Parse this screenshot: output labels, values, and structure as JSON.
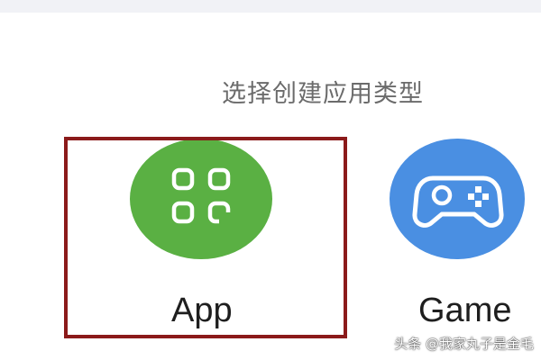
{
  "heading": "选择创建应用类型",
  "app_types": [
    {
      "label": "App",
      "icon": "grid-apps-icon",
      "color": "#5ab043"
    },
    {
      "label": "Game",
      "icon": "gamepad-icon",
      "color": "#4a8fe2"
    }
  ],
  "selected_type": "App",
  "selection_color": "#8b1a1a",
  "watermark": "头条 @我家丸子是金毛"
}
